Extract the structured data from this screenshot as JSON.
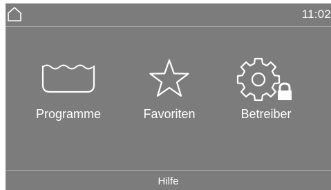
{
  "status_bar": {
    "home_icon": "home-icon",
    "time": "11:02"
  },
  "tiles": [
    {
      "label": "Programme",
      "icon": "wash-tub-icon"
    },
    {
      "label": "Favoriten",
      "icon": "star-icon"
    },
    {
      "label": "Betreiber",
      "icon": "gear-lock-icon"
    }
  ],
  "footer": {
    "label": "Hilfe"
  },
  "colors": {
    "panel": "#7c7c7c",
    "foreground": "#ffffff",
    "divider": "#a8a8a8"
  }
}
